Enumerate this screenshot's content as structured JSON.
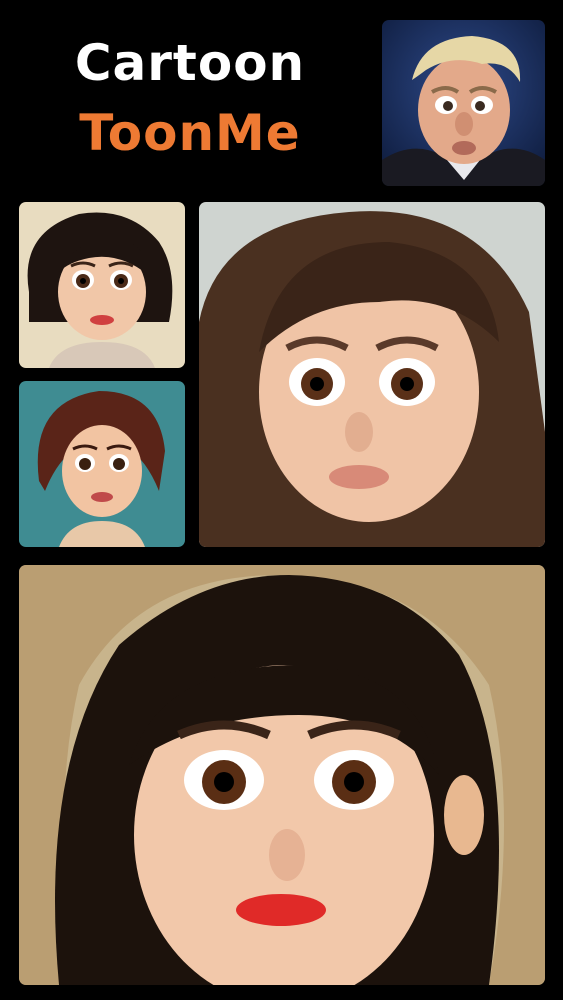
{
  "header": {
    "title_line1": "Cartoon",
    "title_line2": "ToonMe",
    "accent_color": "#ee7a33"
  },
  "gallery": {
    "tiles": [
      {
        "subject": "cartoon-man-portrait"
      },
      {
        "subject": "cartoon-woman-short-hair-portrait"
      },
      {
        "subject": "cartoon-woman-teal-background-portrait"
      },
      {
        "subject": "cartoon-woman-large-portrait"
      },
      {
        "subject": "cartoon-woman-hero-portrait"
      }
    ]
  }
}
